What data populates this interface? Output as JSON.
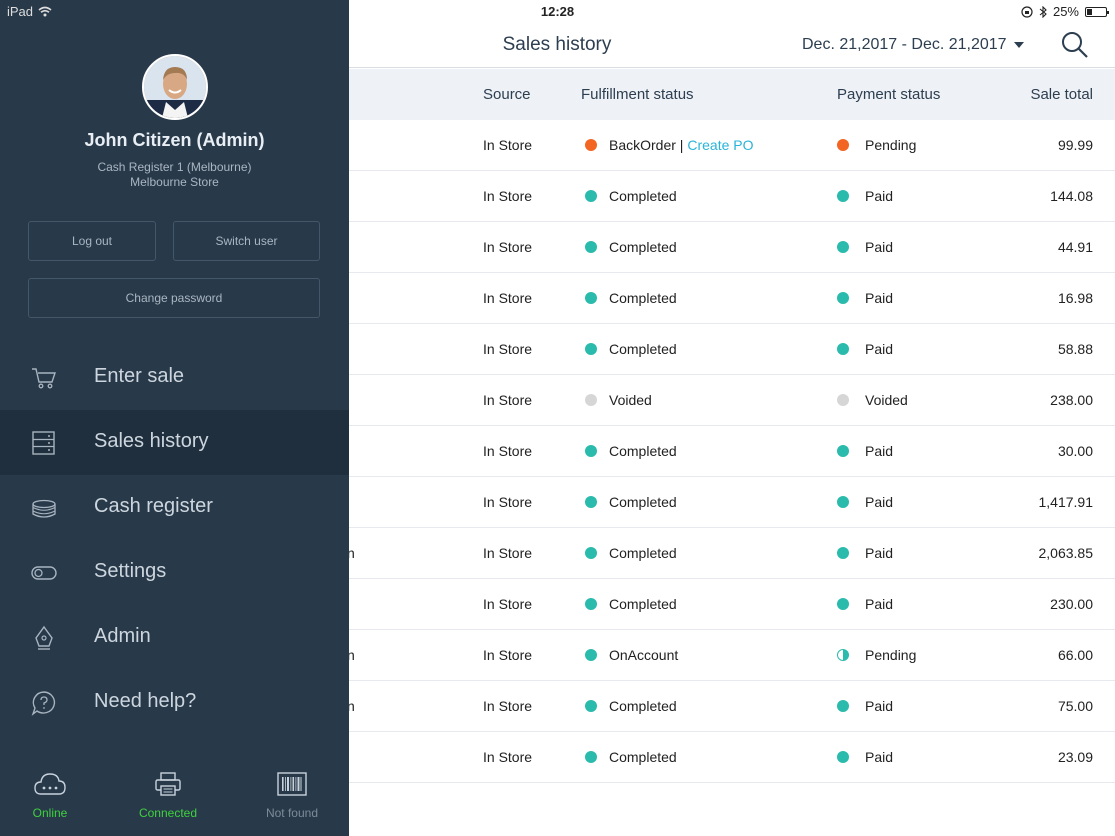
{
  "status_bar": {
    "device": "iPad",
    "time": "12:28",
    "battery": "25%"
  },
  "header": {
    "title": "Sales history",
    "date_range": "Dec. 21,2017 - Dec. 21,2017"
  },
  "table": {
    "columns": {
      "source": "Source",
      "fulfillment": "Fulfillment status",
      "payment": "Payment status",
      "total": "Sale total"
    },
    "rows": [
      {
        "note": "",
        "source": "In Store",
        "fulfillment": "BackOrder",
        "action": "Create PO",
        "payment": "Pending",
        "total": "99.99",
        "f_color": "#f26522",
        "p_color": "#f26522",
        "p_style": "full"
      },
      {
        "note": "",
        "source": "In Store",
        "fulfillment": "Completed",
        "action": "",
        "payment": "Paid",
        "total": "144.08",
        "f_color": "#2bbbad",
        "p_color": "#2bbbad",
        "p_style": "full"
      },
      {
        "note": "",
        "source": "In Store",
        "fulfillment": "Completed",
        "action": "",
        "payment": "Paid",
        "total": "44.91",
        "f_color": "#2bbbad",
        "p_color": "#2bbbad",
        "p_style": "full"
      },
      {
        "note": "",
        "source": "In Store",
        "fulfillment": "Completed",
        "action": "",
        "payment": "Paid",
        "total": "16.98",
        "f_color": "#2bbbad",
        "p_color": "#2bbbad",
        "p_style": "full"
      },
      {
        "note": "",
        "source": "In Store",
        "fulfillment": "Completed",
        "action": "",
        "payment": "Paid",
        "total": "58.88",
        "f_color": "#2bbbad",
        "p_color": "#2bbbad",
        "p_style": "full"
      },
      {
        "note": "",
        "source": "In Store",
        "fulfillment": "Voided",
        "action": "",
        "payment": "Voided",
        "total": "238.00",
        "f_color": "#d6d6d6",
        "p_color": "#d6d6d6",
        "p_style": "full"
      },
      {
        "note": "",
        "source": "In Store",
        "fulfillment": "Completed",
        "action": "",
        "payment": "Paid",
        "total": "30.00",
        "f_color": "#2bbbad",
        "p_color": "#2bbbad",
        "p_style": "full"
      },
      {
        "note": "",
        "source": "In Store",
        "fulfillment": "Completed",
        "action": "",
        "payment": "Paid",
        "total": "1,417.91",
        "f_color": "#2bbbad",
        "p_color": "#2bbbad",
        "p_style": "full"
      },
      {
        "note": "n",
        "source": "In Store",
        "fulfillment": "Completed",
        "action": "",
        "payment": "Paid",
        "total": "2,063.85",
        "f_color": "#2bbbad",
        "p_color": "#2bbbad",
        "p_style": "full"
      },
      {
        "note": "",
        "source": "In Store",
        "fulfillment": "Completed",
        "action": "",
        "payment": "Paid",
        "total": "230.00",
        "f_color": "#2bbbad",
        "p_color": "#2bbbad",
        "p_style": "full"
      },
      {
        "note": "n",
        "source": "In Store",
        "fulfillment": "OnAccount",
        "action": "",
        "payment": "Pending",
        "total": "66.00",
        "f_color": "#2bbbad",
        "p_color": "#2bbbad",
        "p_style": "half"
      },
      {
        "note": "n",
        "source": "In Store",
        "fulfillment": "Completed",
        "action": "",
        "payment": "Paid",
        "total": "75.00",
        "f_color": "#2bbbad",
        "p_color": "#2bbbad",
        "p_style": "full"
      },
      {
        "note": "",
        "source": "In Store",
        "fulfillment": "Completed",
        "action": "",
        "payment": "Paid",
        "total": "23.09",
        "f_color": "#2bbbad",
        "p_color": "#2bbbad",
        "p_style": "full"
      }
    ]
  },
  "drawer": {
    "user": {
      "name": "John Citizen (Admin)",
      "register": "Cash Register 1 (Melbourne)",
      "store": "Melbourne Store"
    },
    "buttons": {
      "logout": "Log out",
      "switch_user": "Switch user",
      "change_password": "Change password"
    },
    "nav": [
      {
        "label": "Enter sale",
        "icon": "cart-icon",
        "active": false
      },
      {
        "label": "Sales history",
        "icon": "server-list-icon",
        "active": true
      },
      {
        "label": "Cash register",
        "icon": "coin-stack-icon",
        "active": false
      },
      {
        "label": "Settings",
        "icon": "toggle-icon",
        "active": false
      },
      {
        "label": "Admin",
        "icon": "pen-nib-icon",
        "active": false
      },
      {
        "label": "Need help?",
        "icon": "help-bubble-icon",
        "active": false
      }
    ],
    "status": [
      {
        "label": "Online",
        "icon": "cloud-icon",
        "color": "#3fd13f"
      },
      {
        "label": "Connected",
        "icon": "printer-icon",
        "color": "#3fd13f"
      },
      {
        "label": "Not found",
        "icon": "barcode-scanner-icon",
        "color": "#7d8b98"
      }
    ]
  }
}
